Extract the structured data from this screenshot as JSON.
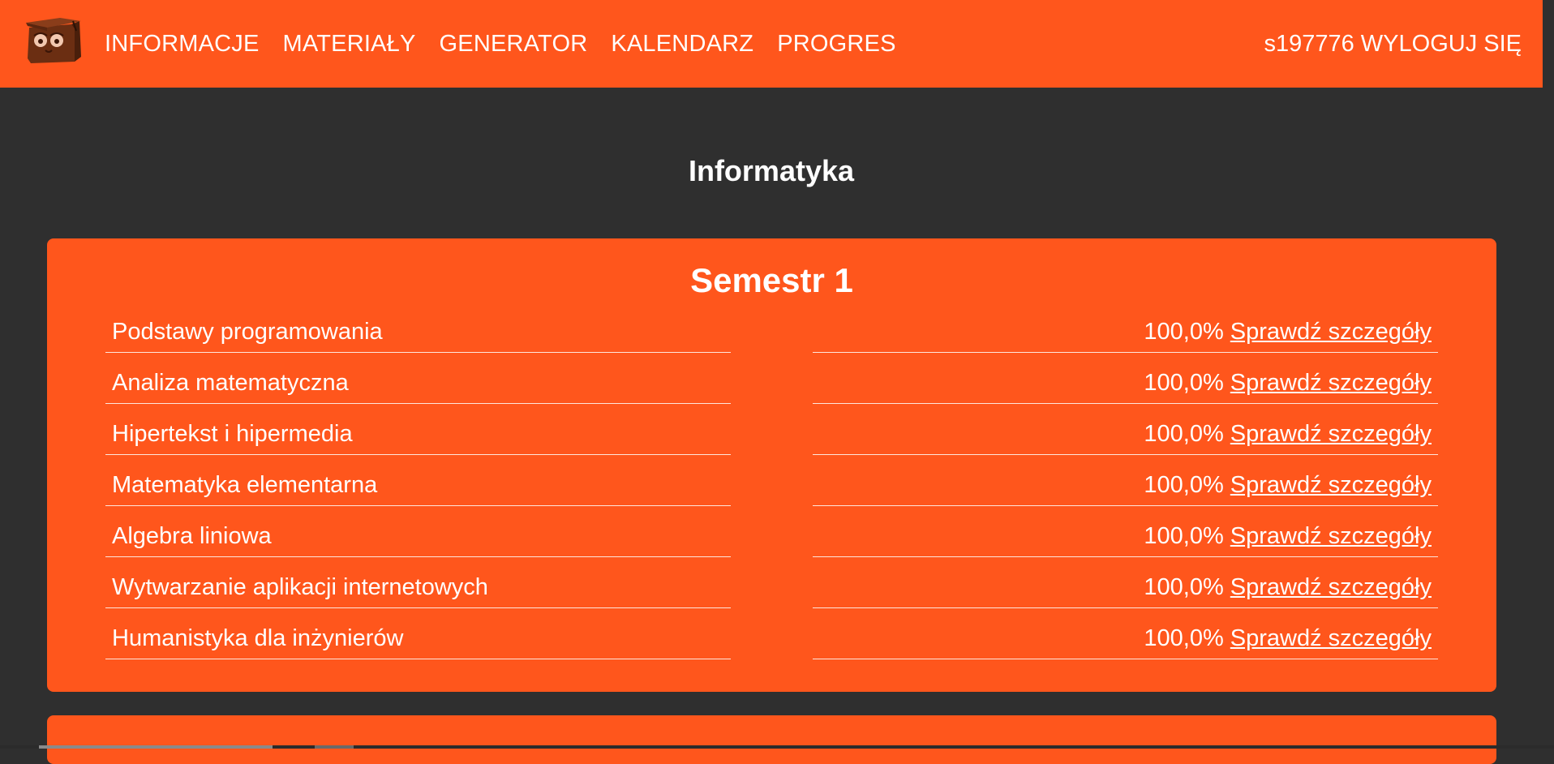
{
  "nav": {
    "links": [
      "INFORMACJE",
      "MATERIAŁY",
      "GENERATOR",
      "KALENDARZ",
      "PROGRES"
    ],
    "user_id": "s197776",
    "logout_label": "WYLOGUJ SIĘ",
    "brand_color": "#ff561c"
  },
  "page": {
    "title": "Informatyka",
    "background_color": "#2f2f2f"
  },
  "semester": {
    "title": "Semestr 1",
    "subjects": [
      {
        "name": "Podstawy programowania",
        "percent": "100,0%",
        "link": "Sprawdź szczegóły"
      },
      {
        "name": "Analiza matematyczna",
        "percent": "100,0%",
        "link": "Sprawdź szczegóły"
      },
      {
        "name": "Hipertekst i hipermedia",
        "percent": "100,0%",
        "link": "Sprawdź szczegóły"
      },
      {
        "name": "Matematyka elementarna",
        "percent": "100,0%",
        "link": "Sprawdź szczegóły"
      },
      {
        "name": "Algebra liniowa",
        "percent": "100,0%",
        "link": "Sprawdź szczegóły"
      },
      {
        "name": "Wytwarzanie aplikacji internetowych",
        "percent": "100,0%",
        "link": "Sprawdź szczegóły"
      },
      {
        "name": "Humanistyka dla inżynierów",
        "percent": "100,0%",
        "link": "Sprawdź szczegóły"
      }
    ]
  }
}
